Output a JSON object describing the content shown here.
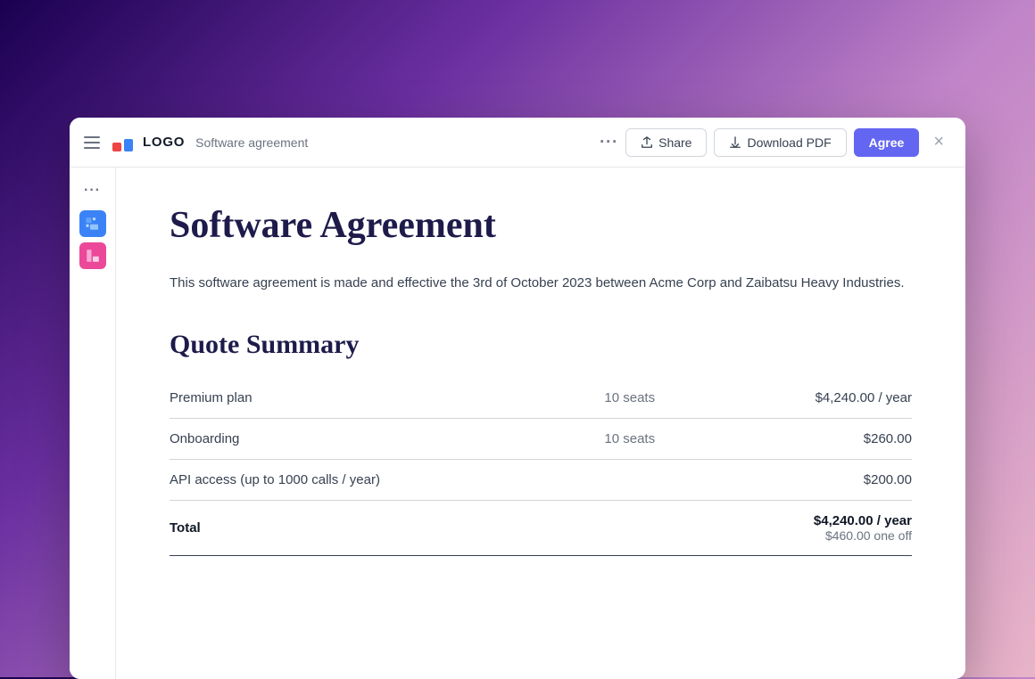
{
  "topbar": {
    "menu_icon_label": "menu",
    "logo_text": "LOGO",
    "doc_title": "Software agreement",
    "more_dots": "···",
    "share_label": "Share",
    "download_label": "Download PDF",
    "agree_label": "Agree",
    "close_label": "×"
  },
  "sidebar": {
    "more_dots": "···",
    "avatar1_initials": "🔵",
    "avatar2_initials": "🟣"
  },
  "document": {
    "main_title": "Software Agreement",
    "intro": "This software agreement is made and effective the 3rd of October 2023 between Acme Corp and Zaibatsu Heavy Industries.",
    "quote_section_title": "Quote Summary",
    "table": {
      "rows": [
        {
          "name": "Premium plan",
          "seats": "10 seats",
          "price": "$4,240.00 / year"
        },
        {
          "name": "Onboarding",
          "seats": "10 seats",
          "price": "$260.00"
        },
        {
          "name": "API access (up to 1000 calls / year)",
          "seats": "",
          "price": "$200.00"
        }
      ],
      "total_label": "Total",
      "total_price_line1": "$4,240.00 / year",
      "total_price_line2": "$460.00 one off"
    }
  }
}
